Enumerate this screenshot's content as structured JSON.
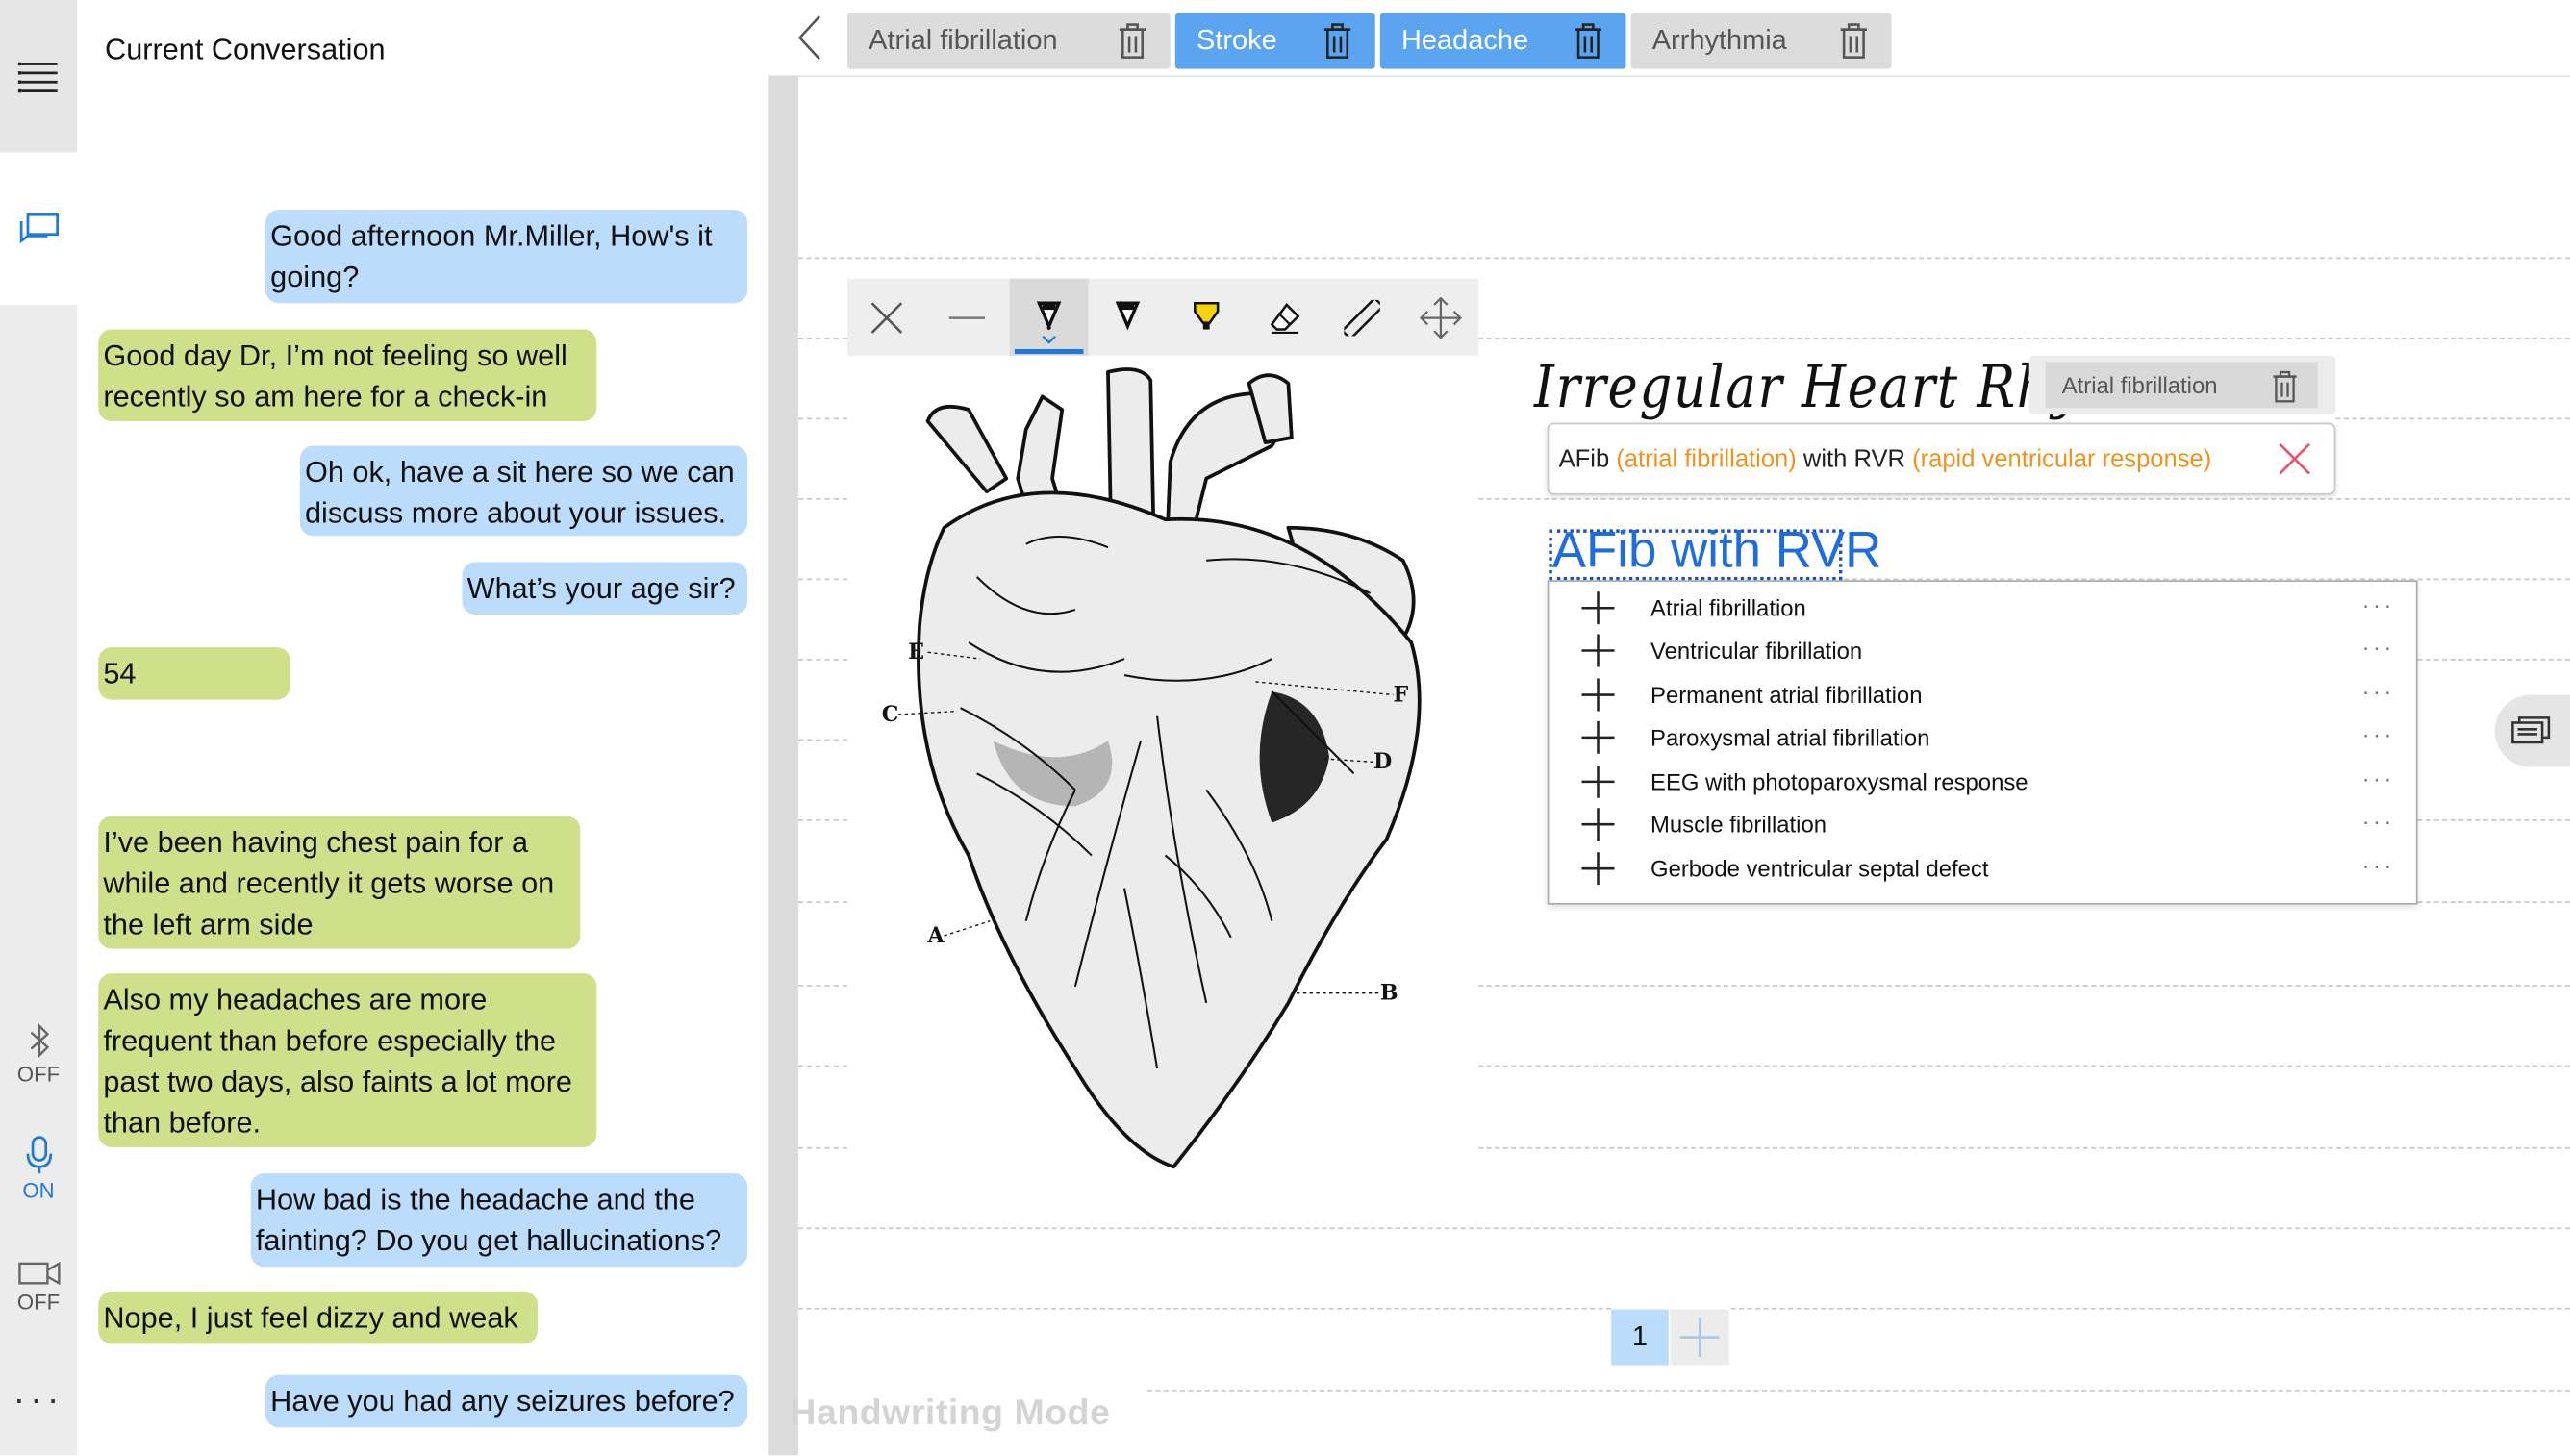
{
  "rail": {
    "bluetooth_state": "OFF",
    "mic_state": "ON",
    "camera_state": "OFF",
    "icons": [
      "menu-icon",
      "conversation-icon",
      "bluetooth-icon",
      "microphone-icon",
      "camera-icon",
      "more-icon"
    ],
    "accent": "#1e7ad6"
  },
  "conversation": {
    "title": "Current Conversation",
    "messages": [
      {
        "speaker": "doctor",
        "text": "Good afternoon Mr.Miller, How's it going?"
      },
      {
        "speaker": "patient",
        "text": "Good day Dr, I’m not feeling so well recently so am here for a check-in"
      },
      {
        "speaker": "doctor",
        "text": "Oh ok, have a sit here so we can discuss more about your issues."
      },
      {
        "speaker": "doctor",
        "text": "What’s your age sir?"
      },
      {
        "speaker": "patient",
        "text": "54"
      },
      {
        "speaker": "patient",
        "text": "I’ve been having chest pain for a while and recently it gets worse on the left arm side"
      },
      {
        "speaker": "patient",
        "text": "Also my headaches are more frequent than before especially the past two days, also faints a lot more than before."
      },
      {
        "speaker": "doctor",
        "text": "How bad is the headache and the fainting? Do you get hallucinations?"
      },
      {
        "speaker": "patient",
        "text": "Nope, I just feel dizzy and weak"
      },
      {
        "speaker": "doctor",
        "text": "Have you had any seizures before?"
      }
    ],
    "colors": {
      "doctor": "#bcdcfb",
      "patient": "#cfdf8a"
    }
  },
  "tabs": [
    {
      "label": "Atrial fibrillation",
      "selected": false
    },
    {
      "label": "Stroke",
      "selected": true
    },
    {
      "label": "Headache",
      "selected": true
    },
    {
      "label": "Arrhythmia",
      "selected": false
    }
  ],
  "toolbar": {
    "tools": [
      "close-icon",
      "line-icon",
      "ballpoint-pen-icon",
      "pencil-icon",
      "highlighter-icon",
      "eraser-icon",
      "ruler-icon",
      "move-icon"
    ],
    "active_tool": "ballpoint-pen-icon"
  },
  "figure": {
    "labels": [
      "E",
      "C",
      "F",
      "D",
      "A",
      "B"
    ]
  },
  "notes": {
    "handwritten_title": "Irregular Heart Rhythm",
    "chip_label": "Atrial fibrillation",
    "suggestion": {
      "part1": "AFib",
      "part2": "(atrial fibrillation)",
      "part3": "with RVR",
      "part4": "(rapid ventricular response)"
    },
    "handwritten_selection": "AFib with RVR"
  },
  "dropdown": {
    "items": [
      "Atrial fibrillation",
      "Ventricular fibrillation",
      "Permanent atrial fibrillation",
      "Paroxysmal atrial fibrillation",
      "EEG with photoparoxysmal response",
      "Muscle fibrillation",
      "Gerbode ventricular septal defect"
    ],
    "more_label": "···"
  },
  "pager": {
    "current_page": "1"
  },
  "mode_label": "Handwriting Mode"
}
